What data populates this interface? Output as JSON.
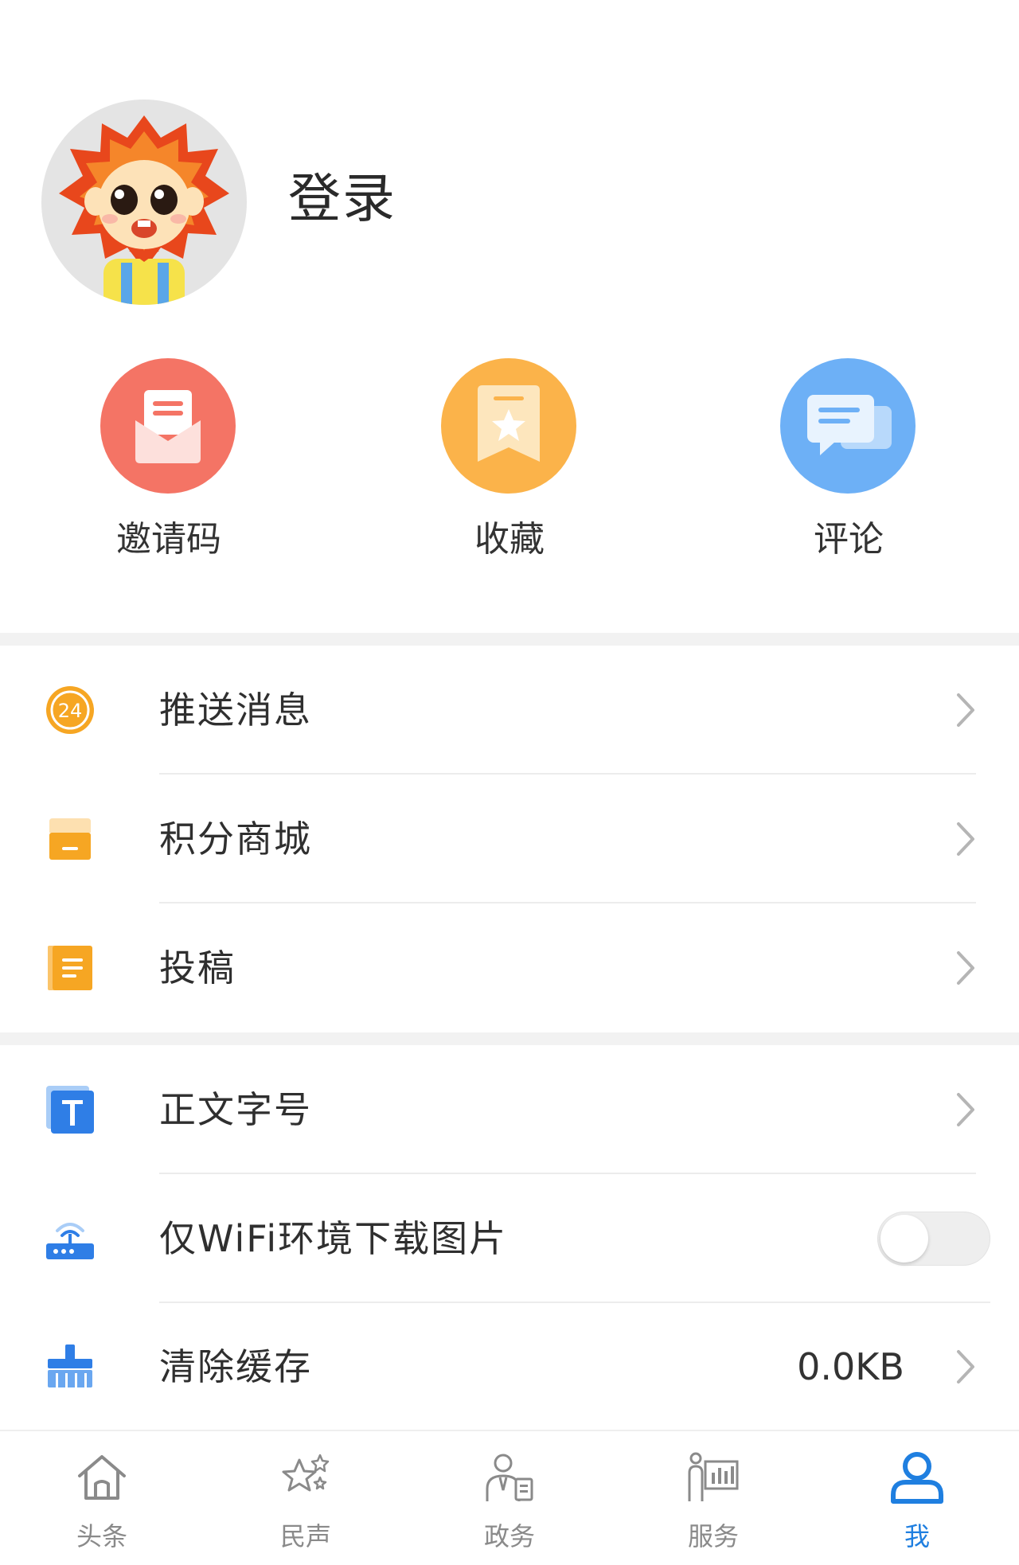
{
  "profile": {
    "login_label": "登录"
  },
  "quick_actions": [
    {
      "label": "邀请码",
      "icon": "envelope-icon",
      "color": "#f47465"
    },
    {
      "label": "收藏",
      "icon": "bookmark-star-icon",
      "color": "#fbb34a"
    },
    {
      "label": "评论",
      "icon": "chat-bubbles-icon",
      "color": "#6db0f6"
    }
  ],
  "menu_group_1": [
    {
      "label": "推送消息",
      "icon": "clock-24-icon",
      "color": "#f6a623"
    },
    {
      "label": "积分商城",
      "icon": "shop-icon",
      "color": "#f6a623"
    },
    {
      "label": "投稿",
      "icon": "document-icon",
      "color": "#f6a623"
    }
  ],
  "menu_group_2": [
    {
      "label": "正文字号",
      "icon": "text-size-icon",
      "color": "#2f7ee6"
    },
    {
      "label": "仅WiFi环境下载图片",
      "icon": "wifi-router-icon",
      "color": "#2f7ee6",
      "toggle_on": false
    },
    {
      "label": "清除缓存",
      "icon": "broom-icon",
      "color": "#2f7ee6",
      "value": "0.0KB"
    }
  ],
  "tabbar": {
    "active_color": "#1f7fe0",
    "inactive_color": "#8a8a8a",
    "items": [
      {
        "label": "头条",
        "icon": "home-icon"
      },
      {
        "label": "民声",
        "icon": "stars-icon"
      },
      {
        "label": "政务",
        "icon": "official-icon"
      },
      {
        "label": "服务",
        "icon": "service-icon"
      },
      {
        "label": "我",
        "icon": "user-icon"
      }
    ]
  }
}
